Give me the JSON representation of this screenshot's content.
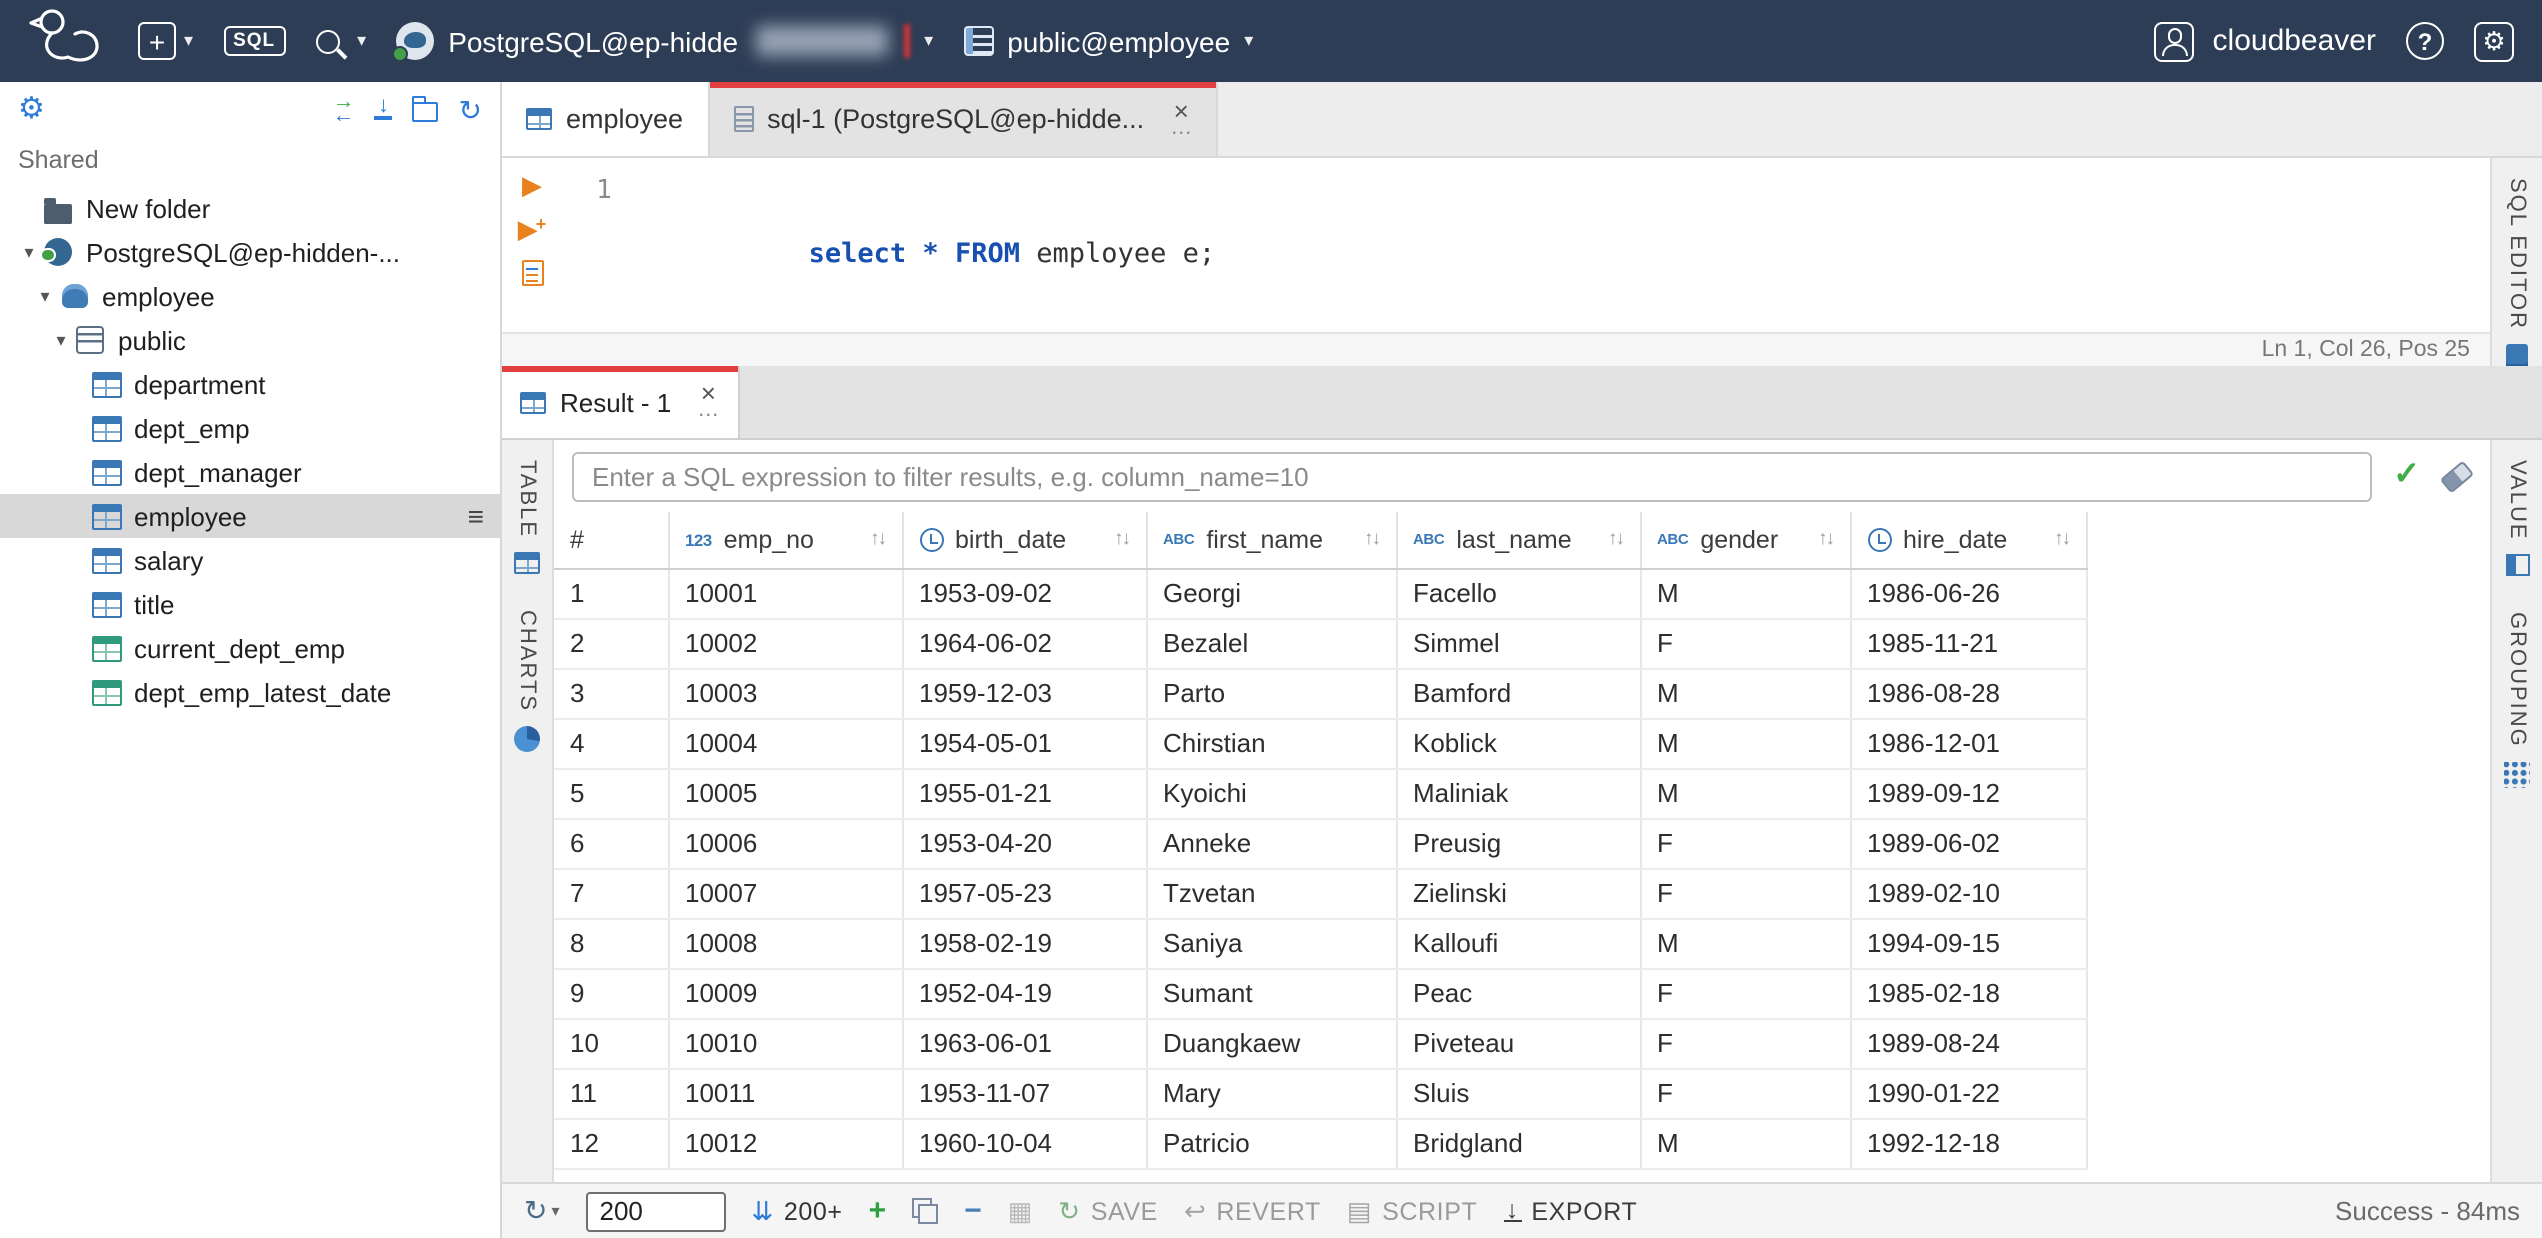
{
  "icons": {
    "chevron_down": "▾",
    "close": "×",
    "more": "…",
    "sort": "↑↓",
    "check": "✓",
    "refresh": "↻",
    "menu": "≡",
    "plus": "+",
    "minus": "−",
    "question": "?",
    "gear": "⚙",
    "play": "▶",
    "collapse": "↓",
    "arrow_right": "→",
    "arrow_left": "←",
    "fetch": "⇊",
    "revert": "↩",
    "script_doc": "▤",
    "export": "↓",
    "grid": "▦"
  },
  "topbar": {
    "sql_badge": "SQL",
    "connection_label": "PostgreSQL@ep-hidde",
    "schema_label": "public@employee",
    "user": "cloudbeaver"
  },
  "sidebar": {
    "section": "Shared",
    "tree": [
      {
        "label": "New folder",
        "cls": "d0 icon-folder",
        "chev": ""
      },
      {
        "label": "PostgreSQL@ep-hidden-...",
        "cls": "d0 icon-pg",
        "chev": "▾"
      },
      {
        "label": "employee",
        "cls": "d1 icon-db",
        "chev": "▾"
      },
      {
        "label": "public",
        "cls": "d2 icon-schema",
        "chev": "▾"
      },
      {
        "label": "department",
        "cls": "d3 icon-table",
        "chev": ""
      },
      {
        "label": "dept_emp",
        "cls": "d3 icon-table",
        "chev": ""
      },
      {
        "label": "dept_manager",
        "cls": "d3 icon-table",
        "chev": ""
      },
      {
        "label": "employee",
        "cls": "d3 icon-table sel",
        "chev": ""
      },
      {
        "label": "salary",
        "cls": "d3 icon-table",
        "chev": ""
      },
      {
        "label": "title",
        "cls": "d3 icon-table",
        "chev": ""
      },
      {
        "label": "current_dept_emp",
        "cls": "d3 icon-view",
        "chev": ""
      },
      {
        "label": "dept_emp_latest_date",
        "cls": "d3 icon-view",
        "chev": ""
      }
    ]
  },
  "editor_tabs": [
    {
      "label": "employee",
      "cls": "",
      "icon_cls": "gicon"
    },
    {
      "label": "sql-1 (PostgreSQL@ep-hidde...",
      "cls": "act",
      "icon_cls": "doc-icon"
    }
  ],
  "sql_editor": {
    "line": "1",
    "tokens": [
      {
        "t": "select",
        "c": "kw"
      },
      {
        "t": " ",
        "c": ""
      },
      {
        "t": "*",
        "c": "kw"
      },
      {
        "t": " ",
        "c": ""
      },
      {
        "t": "FROM",
        "c": "kw"
      },
      {
        "t": " ",
        "c": ""
      },
      {
        "t": "employee e;",
        "c": ""
      }
    ],
    "status": "Ln 1, Col 26, Pos 25",
    "panel": "SQL EDITOR"
  },
  "result": {
    "tab": "Result - 1",
    "filter_placeholder": "Enter a SQL expression to filter results, e.g. column_name=10",
    "left_tabs": [
      {
        "label": "TABLE",
        "icon_cls": "gicon"
      },
      {
        "label": "CHARTS",
        "icon_cls": "pie-icon"
      }
    ],
    "right_tabs": [
      {
        "label": "VALUE",
        "icon_cls": "value-icon"
      },
      {
        "label": "GROUPING",
        "icon_cls": "group-icon"
      }
    ],
    "columns": [
      {
        "label": "#",
        "type": "plain",
        "icon_text": ""
      },
      {
        "label": "emp_no",
        "type": "num",
        "icon_text": "123"
      },
      {
        "label": "birth_date",
        "type": "date",
        "icon_text": ""
      },
      {
        "label": "first_name",
        "type": "text",
        "icon_text": "ABC"
      },
      {
        "label": "last_name",
        "type": "text",
        "icon_text": "ABC"
      },
      {
        "label": "gender",
        "type": "text",
        "icon_text": "ABC"
      },
      {
        "label": "hire_date",
        "type": "date",
        "icon_text": ""
      }
    ],
    "rows": [
      [
        "1",
        "10001",
        "1953-09-02",
        "Georgi",
        "Facello",
        "M",
        "1986-06-26"
      ],
      [
        "2",
        "10002",
        "1964-06-02",
        "Bezalel",
        "Simmel",
        "F",
        "1985-11-21"
      ],
      [
        "3",
        "10003",
        "1959-12-03",
        "Parto",
        "Bamford",
        "M",
        "1986-08-28"
      ],
      [
        "4",
        "10004",
        "1954-05-01",
        "Chirstian",
        "Koblick",
        "M",
        "1986-12-01"
      ],
      [
        "5",
        "10005",
        "1955-01-21",
        "Kyoichi",
        "Maliniak",
        "M",
        "1989-09-12"
      ],
      [
        "6",
        "10006",
        "1953-04-20",
        "Anneke",
        "Preusig",
        "F",
        "1989-06-02"
      ],
      [
        "7",
        "10007",
        "1957-05-23",
        "Tzvetan",
        "Zielinski",
        "F",
        "1989-02-10"
      ],
      [
        "8",
        "10008",
        "1958-02-19",
        "Saniya",
        "Kalloufi",
        "M",
        "1994-09-15"
      ],
      [
        "9",
        "10009",
        "1952-04-19",
        "Sumant",
        "Peac",
        "F",
        "1985-02-18"
      ],
      [
        "10",
        "10010",
        "1963-06-01",
        "Duangkaew",
        "Piveteau",
        "F",
        "1989-08-24"
      ],
      [
        "11",
        "10011",
        "1953-11-07",
        "Mary",
        "Sluis",
        "F",
        "1990-01-22"
      ],
      [
        "12",
        "10012",
        "1960-10-04",
        "Patricio",
        "Bridgland",
        "M",
        "1992-12-18"
      ]
    ],
    "toolbar": {
      "fetch_value": "200",
      "fetch_more": "200+",
      "save": "SAVE",
      "revert": "REVERT",
      "script": "SCRIPT",
      "export": "EXPORT"
    },
    "status": "Success - 84ms"
  },
  "colors": {
    "topbar_bg": "#2e3d56",
    "accent_blue": "#3a78b5",
    "tab_accent_red": "#e24040",
    "success_green": "#3fae49",
    "exec_orange": "#e8821e",
    "postgres_blue": "#336791"
  }
}
